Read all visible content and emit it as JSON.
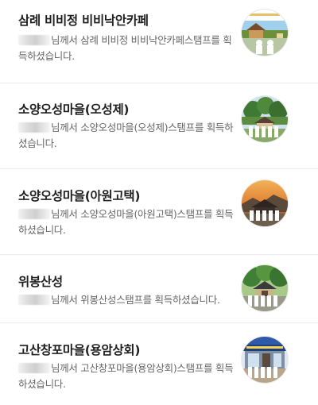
{
  "feed": {
    "items": [
      {
        "title": "삼례 비비정 비비낙안카페",
        "message": "님께서 삼례 비비정 비비낙안카페스탬프를 획득하셨습니다.",
        "thumb_icon": "stamp-photo-bibijeong"
      },
      {
        "title": "소양오성마을(오성제)",
        "message": "님께서 소양오성마을(오성제)스탬프를 획득하셨습니다.",
        "thumb_icon": "stamp-photo-oseongje"
      },
      {
        "title": "소양오성마을(아원고택)",
        "message": "님께서 소양오성마을(아원고택)스탬프를 획득하셨습니다.",
        "thumb_icon": "stamp-photo-awon-gotaek"
      },
      {
        "title": "위봉산성",
        "message": "님께서 위봉산성스탬프를 획득하셨습니다.",
        "thumb_icon": "stamp-photo-wibongsanseong"
      },
      {
        "title": "고산창포마을(용암상회)",
        "message": "님께서 고산창포마을(용암상회)스탬프를 획득하셨습니다.",
        "thumb_icon": "stamp-photo-yongam-store"
      }
    ]
  }
}
